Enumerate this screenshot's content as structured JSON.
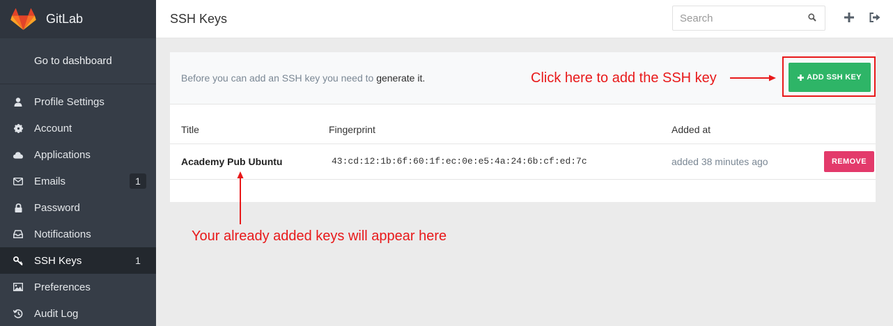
{
  "brand": {
    "name": "GitLab"
  },
  "sidebar": {
    "dashboard_label": "Go to dashboard",
    "items": [
      {
        "label": "Profile Settings",
        "icon": "user-icon",
        "count": ""
      },
      {
        "label": "Account",
        "icon": "gear-icon",
        "count": ""
      },
      {
        "label": "Applications",
        "icon": "cloud-icon",
        "count": ""
      },
      {
        "label": "Emails",
        "icon": "envelope-icon",
        "count": "1"
      },
      {
        "label": "Password",
        "icon": "lock-icon",
        "count": ""
      },
      {
        "label": "Notifications",
        "icon": "inbox-icon",
        "count": ""
      },
      {
        "label": "SSH Keys",
        "icon": "key-icon",
        "count": "1"
      },
      {
        "label": "Preferences",
        "icon": "image-icon",
        "count": ""
      },
      {
        "label": "Audit Log",
        "icon": "history-icon",
        "count": ""
      }
    ],
    "active_index": 6
  },
  "header": {
    "title": "SSH Keys",
    "search_placeholder": "Search"
  },
  "panel": {
    "hint_text": "Before you can add an SSH key you need to ",
    "hint_link": "generate it.",
    "add_button_label": "ADD SSH KEY",
    "columns": [
      "Title",
      "Fingerprint",
      "Added at"
    ],
    "keys": [
      {
        "title": "Academy Pub Ubuntu",
        "fingerprint": "43:cd:12:1b:6f:60:1f:ec:0e:e5:4a:24:6b:cf:ed:7c",
        "added": "added 38 minutes ago",
        "remove_label": "REMOVE"
      }
    ]
  },
  "annotations": {
    "add_callout": "Click here to add the SSH key",
    "list_callout": "Your already added keys will appear here"
  },
  "colors": {
    "sidebar_bg": "#363d47",
    "add_button": "#2eb567",
    "remove_button": "#e33a6b",
    "annotation_red": "#e8191a"
  }
}
